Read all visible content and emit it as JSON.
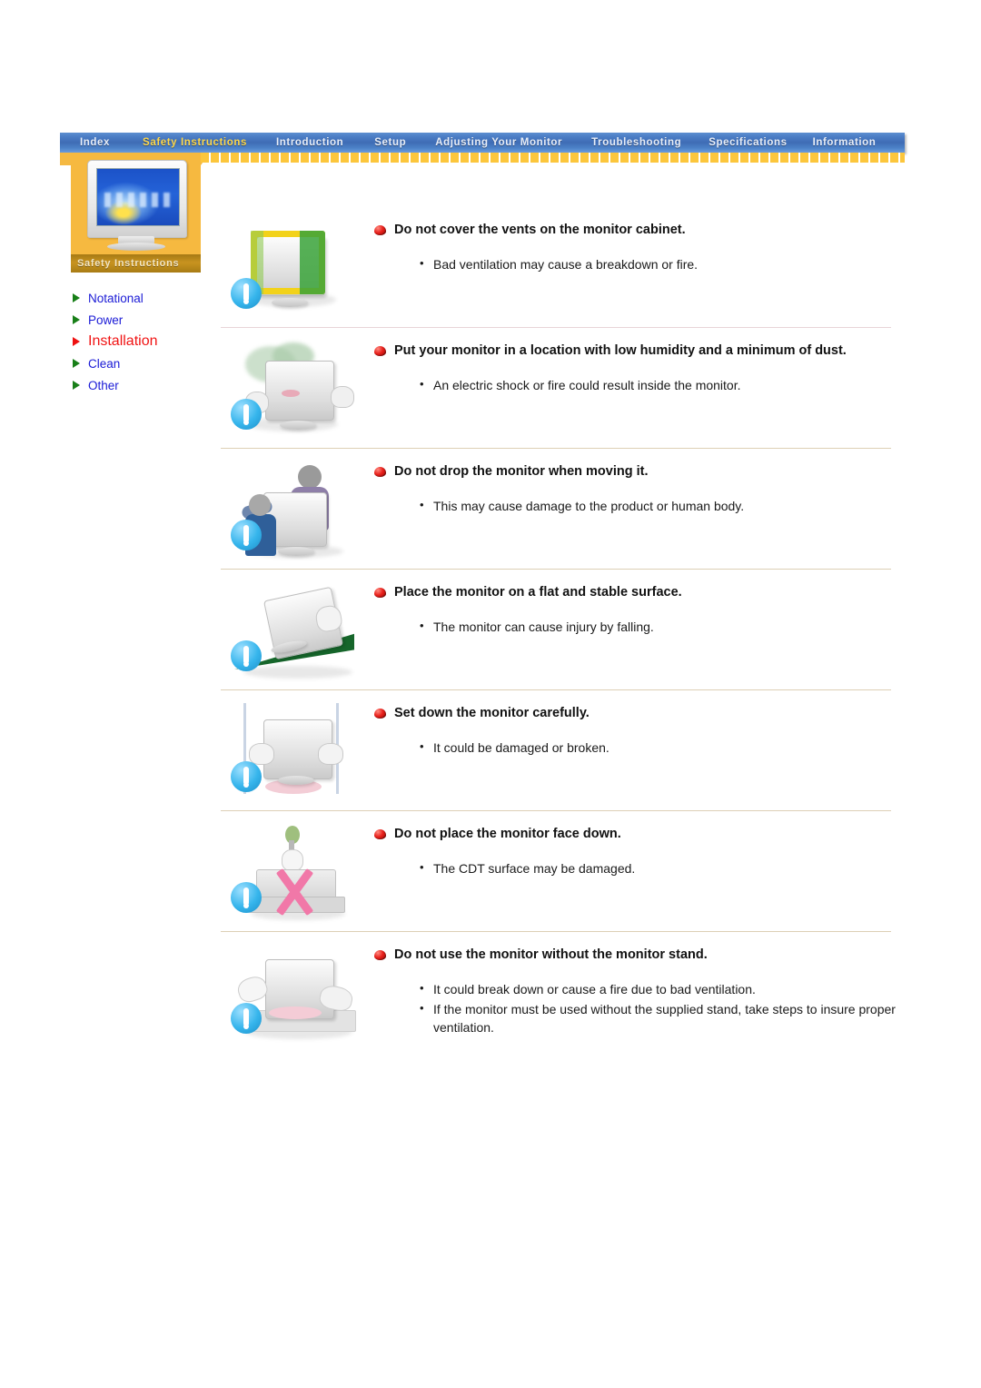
{
  "nav": {
    "items": [
      {
        "label": "Index",
        "active": false
      },
      {
        "label": "Safety Instructions",
        "active": true
      },
      {
        "label": "Introduction",
        "active": false
      },
      {
        "label": "Setup",
        "active": false
      },
      {
        "label": "Adjusting Your Monitor",
        "active": false
      },
      {
        "label": "Troubleshooting",
        "active": false
      },
      {
        "label": "Specifications",
        "active": false
      },
      {
        "label": "Information",
        "active": false
      }
    ]
  },
  "sidebar": {
    "caption": "Safety Instructions",
    "thumbnail_alt": "monitor-thumbnail",
    "links": [
      {
        "label": "Notational",
        "active": false
      },
      {
        "label": "Power",
        "active": false
      },
      {
        "label": "Installation",
        "active": true
      },
      {
        "label": "Clean",
        "active": false
      },
      {
        "label": "Other",
        "active": false
      }
    ]
  },
  "main": {
    "sections": [
      {
        "illustration": "monitor-with-vents-covered",
        "heading": "Do not cover the vents on the monitor cabinet.",
        "bullets": [
          "Bad ventilation may cause a breakdown or fire."
        ],
        "separator": "pink"
      },
      {
        "illustration": "monitor-in-dusty-humid-place",
        "heading": "Put your monitor in a location with low humidity and a minimum of dust.",
        "bullets": [
          "An electric shock or fire could result inside the monitor."
        ],
        "separator": "tan"
      },
      {
        "illustration": "person-dropping-monitor",
        "heading": "Do not drop the monitor when moving it.",
        "bullets": [
          "This may cause damage to the product or human body."
        ],
        "separator": "tan"
      },
      {
        "illustration": "monitor-on-sloped-surface",
        "heading": "Place the monitor on a flat and stable surface.",
        "bullets": [
          "The monitor can cause injury by falling."
        ],
        "separator": "tan"
      },
      {
        "illustration": "monitor-being-set-down",
        "heading": "Set down the monitor carefully.",
        "bullets": [
          "It could be damaged or broken."
        ],
        "separator": "tan"
      },
      {
        "illustration": "monitor-face-down-crossed-out",
        "heading": "Do not place the monitor face down.",
        "bullets": [
          "The CDT surface may be damaged."
        ],
        "separator": "tan"
      },
      {
        "illustration": "monitor-without-stand",
        "heading": "Do not use the monitor without the monitor stand.",
        "bullets": [
          "It could break down or cause a fire due to bad ventilation.",
          "If the monitor must be used without the supplied stand, take steps to insure proper ventilation."
        ],
        "separator": "none"
      }
    ]
  },
  "colors": {
    "nav_blue": "#4a7cc4",
    "nav_active_text": "#ffd84a",
    "strip_yellow": "#f5b942",
    "sidebar_orange": "#f6b940",
    "caption_brown": "#c89320",
    "link_blue": "#1a1ad6",
    "active_red": "#f01414",
    "arrow_green": "#187f18",
    "separator_pink": "#e8d4d8",
    "separator_tan": "#ddcfb5"
  }
}
